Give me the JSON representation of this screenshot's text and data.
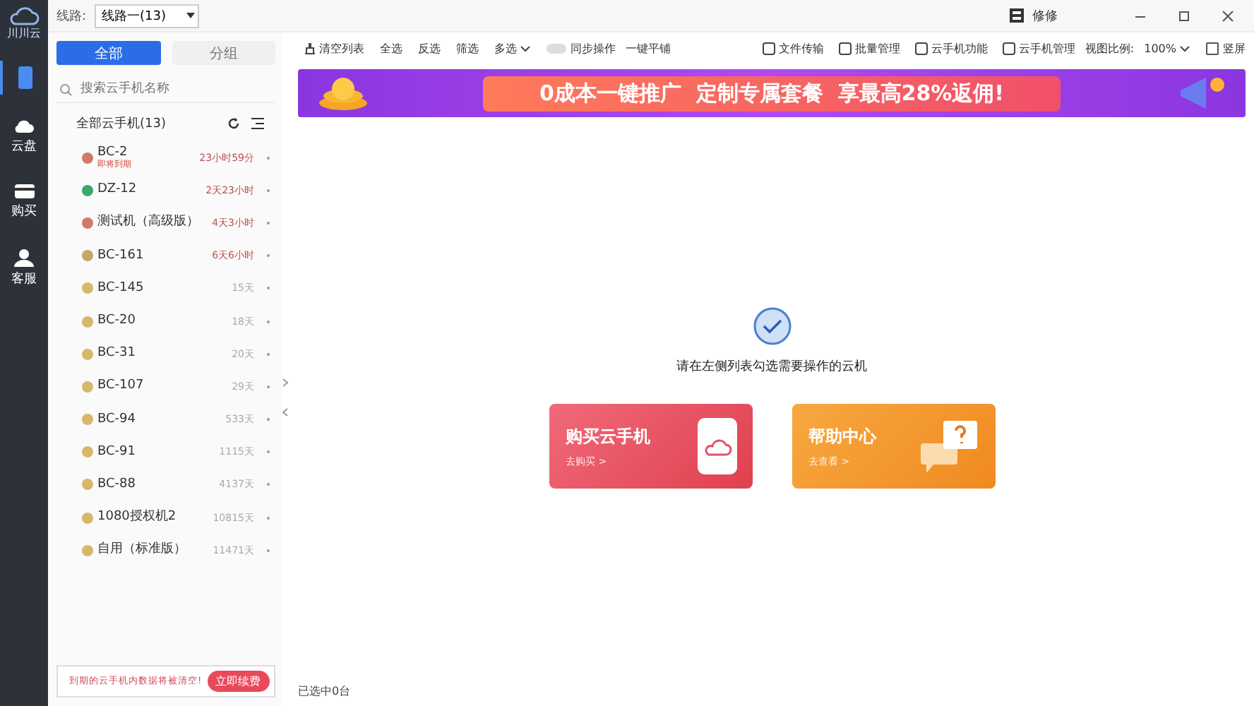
{
  "window": {
    "title": "修修",
    "route_label": "线路:",
    "route_value": "线路一(13)"
  },
  "rail": {
    "logo": "川川云",
    "items": [
      {
        "kind": "phone",
        "selected": true
      },
      {
        "label": "云盘",
        "kind": "cloud",
        "selected": false
      },
      {
        "label": "购买",
        "kind": "card",
        "selected": false
      },
      {
        "label": "客服",
        "kind": "person",
        "selected": false
      }
    ]
  },
  "sidebar": {
    "tabs": [
      {
        "label": "全部",
        "selected": true
      },
      {
        "label": "分组",
        "selected": false
      }
    ],
    "search": {
      "placeholder": "搜索云手机名称"
    },
    "group_title": "全部云手机(13)",
    "items": [
      {
        "name": "BC-2",
        "note": "即将到期",
        "time": "23小时59分",
        "color": "#d07a6a",
        "urgent": true
      },
      {
        "name": "DZ-12",
        "time": "2天23小时",
        "color": "#3aa86b",
        "urgent": true
      },
      {
        "name": "测试机（高级版）",
        "time": "4天3小时",
        "color": "#d07a6a",
        "urgent": true
      },
      {
        "name": "BC-161",
        "time": "6天6小时",
        "color": "#c9a46a",
        "urgent": true
      },
      {
        "name": "BC-145",
        "time": "15天",
        "color": "#d6b86a",
        "urgent": false
      },
      {
        "name": "BC-20",
        "time": "18天",
        "color": "#d6b86a",
        "urgent": false
      },
      {
        "name": "BC-31",
        "time": "20天",
        "color": "#d6b86a",
        "urgent": false
      },
      {
        "name": "BC-107",
        "time": "29天",
        "color": "#d6b86a",
        "urgent": false
      },
      {
        "name": "BC-94",
        "time": "533天",
        "color": "#d6b86a",
        "urgent": false
      },
      {
        "name": "BC-91",
        "time": "1115天",
        "color": "#d6b86a",
        "urgent": false
      },
      {
        "name": "BC-88",
        "time": "4137天",
        "color": "#d6b86a",
        "urgent": false
      },
      {
        "name": "1080授权机2",
        "time": "10815天",
        "color": "#d6b86a",
        "urgent": false
      },
      {
        "name": "自用（标准版）",
        "time": "11471天",
        "color": "#d6b86a",
        "urgent": false
      }
    ],
    "notice": {
      "text": "到期的云手机内数据将被清空!",
      "button": "立即续费"
    }
  },
  "toolbar": {
    "left": [
      {
        "label": "清空列表",
        "kind": "icon"
      },
      {
        "label": "全选",
        "kind": "plain"
      },
      {
        "label": "反选",
        "kind": "plain"
      },
      {
        "label": "筛选",
        "kind": "plain"
      },
      {
        "label": "多选",
        "kind": "caret"
      },
      {
        "label": "同步操作",
        "kind": "toggle",
        "on": false
      },
      {
        "label": "一键平铺",
        "kind": "plain"
      }
    ],
    "right": [
      {
        "label": "文件传输"
      },
      {
        "label": "批量管理"
      },
      {
        "label": "云手机功能"
      },
      {
        "label": "云手机管理"
      }
    ],
    "zoom_label": "视图比例:",
    "zoom_value": "100%",
    "portrait": {
      "label": "竖屏",
      "checked": false
    }
  },
  "banner": {
    "text": "0成本一键推广  定制专属套餐  享最高28%返佣!"
  },
  "empty": {
    "message": "请在左侧列表勾选需要操作的云机"
  },
  "cards": [
    {
      "title": "购买云手机",
      "link": "去购买 >",
      "kind": "buy"
    },
    {
      "title": "帮助中心",
      "link": "去查看 >",
      "kind": "help"
    }
  ],
  "status_bar": {
    "text": "已选中0台"
  }
}
